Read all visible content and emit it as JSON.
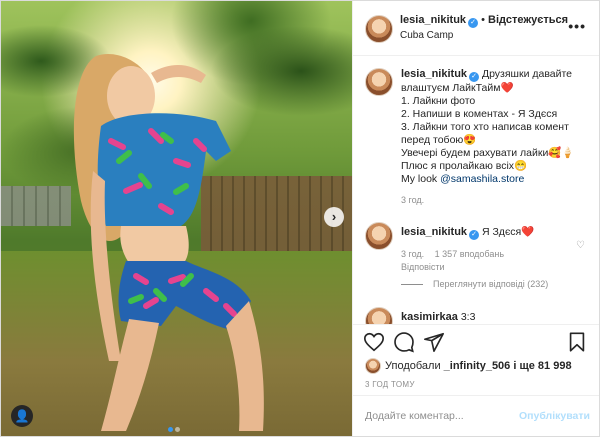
{
  "post": {
    "author": {
      "username": "lesia_nikituk",
      "follow_label": "Відстежується",
      "location": "Cuba Camp"
    },
    "more_label": "•••",
    "photo": {
      "next_label": "›",
      "slides": 2,
      "active_slide": 0
    },
    "caption": {
      "username": "lesia_nikituk",
      "lines": [
        "Друзяшки давайте",
        "влаштуєм ЛайкТайм❤️",
        "1. Лайкни фото",
        "2. Напиши в коментах - Я Здєся",
        "3. Лайкни того хто написав комент",
        "перед тобою😍",
        "Увечері будем рахувати лайки🥰🍦",
        "Плюс я пролайкаю всіх😁",
        "My look @samashila.store"
      ],
      "mention": "@samashila.store",
      "time": "3 год."
    },
    "comments": [
      {
        "username": "lesia_nikituk",
        "text": "Я Здєся❤️",
        "time": "3 год.",
        "likes": "1 357 вподобань",
        "reply_label": "Відповісти",
        "view_replies": "Переглянути відповіді (232)"
      },
      {
        "username": "kasimirkaa",
        "text": "3:3"
      }
    ],
    "likes": {
      "prefix": "Уподобали",
      "user": "_infinity_506",
      "rest": "і ще 81 998"
    },
    "timestamp": "3 ГОД ТОМУ",
    "add_comment_placeholder": "Додайте коментар...",
    "publish_label": "Опублікувати"
  },
  "colors": {
    "accent": "#3897f0",
    "publish_disabled": "#b2dffc",
    "heart": "#ed4956"
  }
}
